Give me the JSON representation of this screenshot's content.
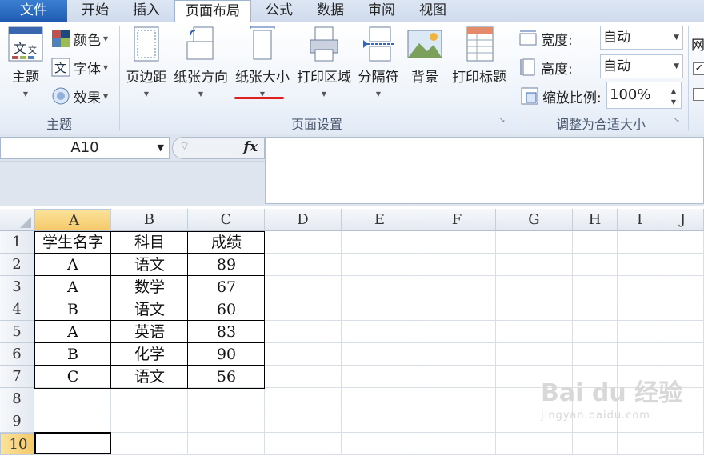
{
  "tabs": [
    {
      "label": "文件"
    },
    {
      "label": "开始"
    },
    {
      "label": "插入"
    },
    {
      "label": "页面布局"
    },
    {
      "label": "公式"
    },
    {
      "label": "数据"
    },
    {
      "label": "审阅"
    },
    {
      "label": "视图"
    }
  ],
  "ribbon": {
    "themes": {
      "group_label": "主题",
      "theme_button": "主题",
      "colors": "颜色",
      "fonts": "字体",
      "effects": "效果"
    },
    "page_setup": {
      "group_label": "页面设置",
      "margins": "页边距",
      "orientation": "纸张方向",
      "size": "纸张大小",
      "print_area": "打印区域",
      "breaks": "分隔符",
      "background": "背景",
      "print_titles": "打印标题"
    },
    "scale_to_fit": {
      "group_label": "调整为合适大小",
      "width_label": "宽度:",
      "width_value": "自动",
      "height_label": "高度:",
      "height_value": "自动",
      "scale_label": "缩放比例:",
      "scale_value": "100%"
    },
    "sheet_options": {
      "label_partial": "网"
    }
  },
  "formula_bar": {
    "name_box": "A10",
    "fx": "fx",
    "content": ""
  },
  "grid": {
    "columns": [
      "A",
      "B",
      "C",
      "D",
      "E",
      "F",
      "G",
      "H",
      "I",
      "J"
    ],
    "rows": [
      "1",
      "2",
      "3",
      "4",
      "5",
      "6",
      "7",
      "8",
      "9",
      "10"
    ],
    "selected_cell": "A10",
    "data": [
      [
        "学生名字",
        "科目",
        "成绩"
      ],
      [
        "A",
        "语文",
        "89"
      ],
      [
        "A",
        "数学",
        "67"
      ],
      [
        "B",
        "语文",
        "60"
      ],
      [
        "A",
        "英语",
        "83"
      ],
      [
        "B",
        "化学",
        "90"
      ],
      [
        "C",
        "语文",
        "56"
      ]
    ]
  },
  "accent_colors": {
    "file_tab": "#2b6cc4",
    "selection_header": "#f5c969",
    "underline_red": "#e02020"
  },
  "watermark": {
    "text": "Bai du 经验",
    "sub": "jingyan.baidu.com"
  }
}
